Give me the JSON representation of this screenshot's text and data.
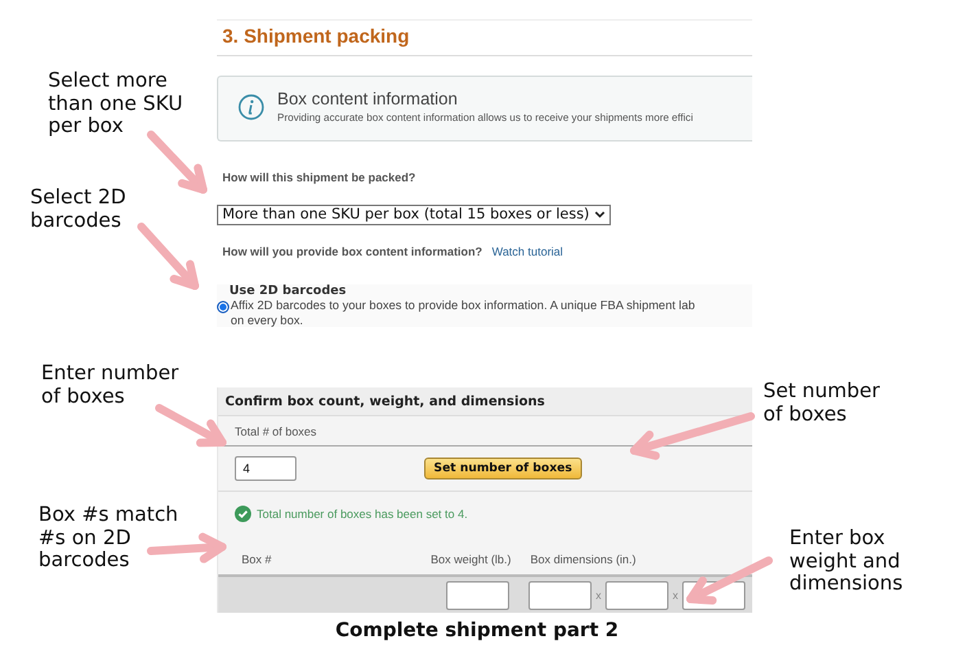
{
  "screen": {
    "section_title": "3. Shipment packing",
    "info": {
      "title": "Box content information",
      "text": "Providing accurate box content information allows us to receive your shipments more effici"
    },
    "packing_question": "How will this shipment be packed?",
    "packing_select": {
      "value": "More than one SKU per box (total 15 boxes or less)"
    },
    "info_question": "How will you provide box content information?",
    "tutorial_link": "Watch tutorial",
    "option": {
      "title": "Use 2D barcodes",
      "text": "Affix 2D barcodes to your boxes to provide box information. A unique FBA shipment lab\non every box.",
      "selected": true
    },
    "confirm": {
      "header": "Confirm box count, weight, and dimensions",
      "total_label": "Total # of boxes",
      "total_value": "4",
      "set_button": "Set number of boxes",
      "confirmation": "Total number of boxes has been set to 4.",
      "columns": [
        "Box #",
        "Box weight (lb.)",
        "Box dimensions (in.)"
      ],
      "separators": [
        "x",
        "x"
      ]
    }
  },
  "left_annotations": [
    "Select more\nthan one SKU\nper box",
    "Select 2D\nbarcodes",
    "Enter number\nof boxes",
    "Box #s match\n#s on 2D\nbarcodes"
  ],
  "right_annotations": [
    "Set number\nof boxes",
    "Enter box\nweight and\ndimensions"
  ],
  "caption": "Complete shipment part 2"
}
